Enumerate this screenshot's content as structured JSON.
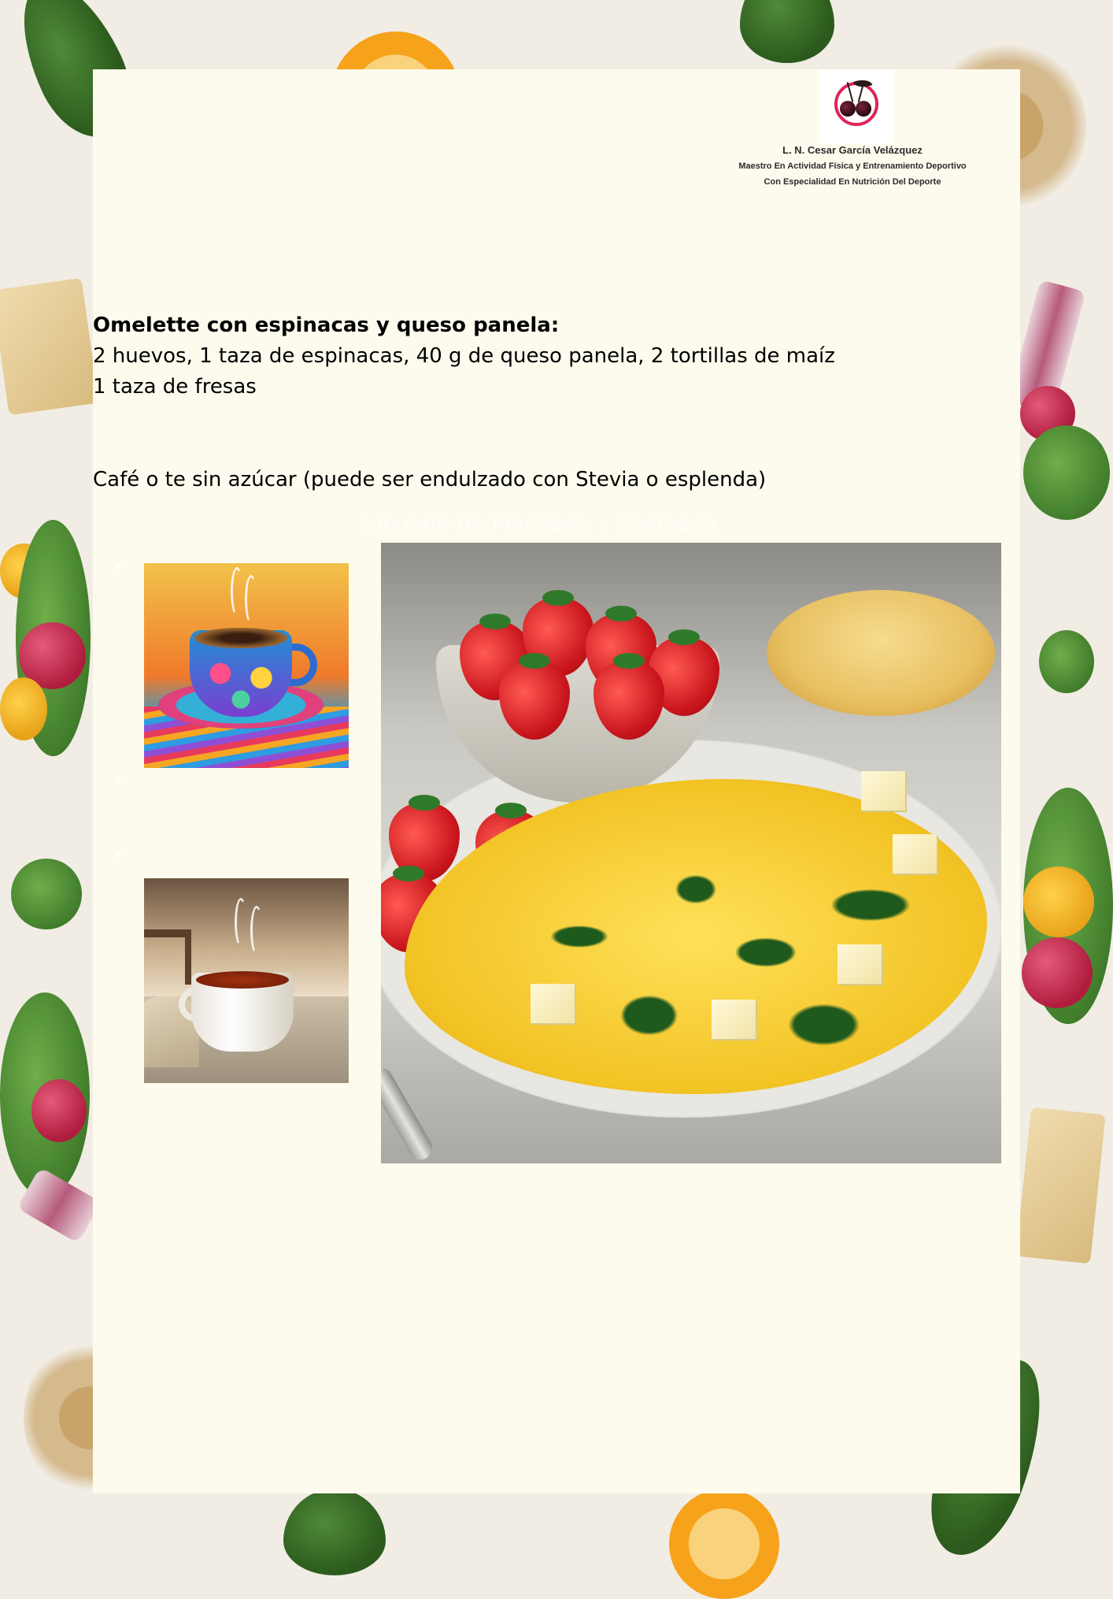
{
  "branding": {
    "author_name": "L. N. Cesar García Velázquez",
    "credential_line_1": "Maestro En Actividad Física y Entrenamiento Deportivo",
    "credential_line_2": "Con Especialidad En Nutrición Del Deporte",
    "logo_icon": "cherry-logo-icon",
    "logo_color": "#e02459"
  },
  "recipe": {
    "title": "Omelette con espinacas y queso panela:",
    "ingredients": "2 huevos, 1 taza de espinacas, 40 g de queso panela, 2 tortillas de maíz",
    "fruit": "1 taza de fresas",
    "drink": "Café o te sin azúcar (puede ser endulzado con Stevia o esplenda)"
  },
  "faded_heading": "Licuado de Manzana y Espinaca",
  "colors": {
    "page_background": "#f1ede4",
    "card_background": "#fdfbed",
    "text": "#000000"
  }
}
